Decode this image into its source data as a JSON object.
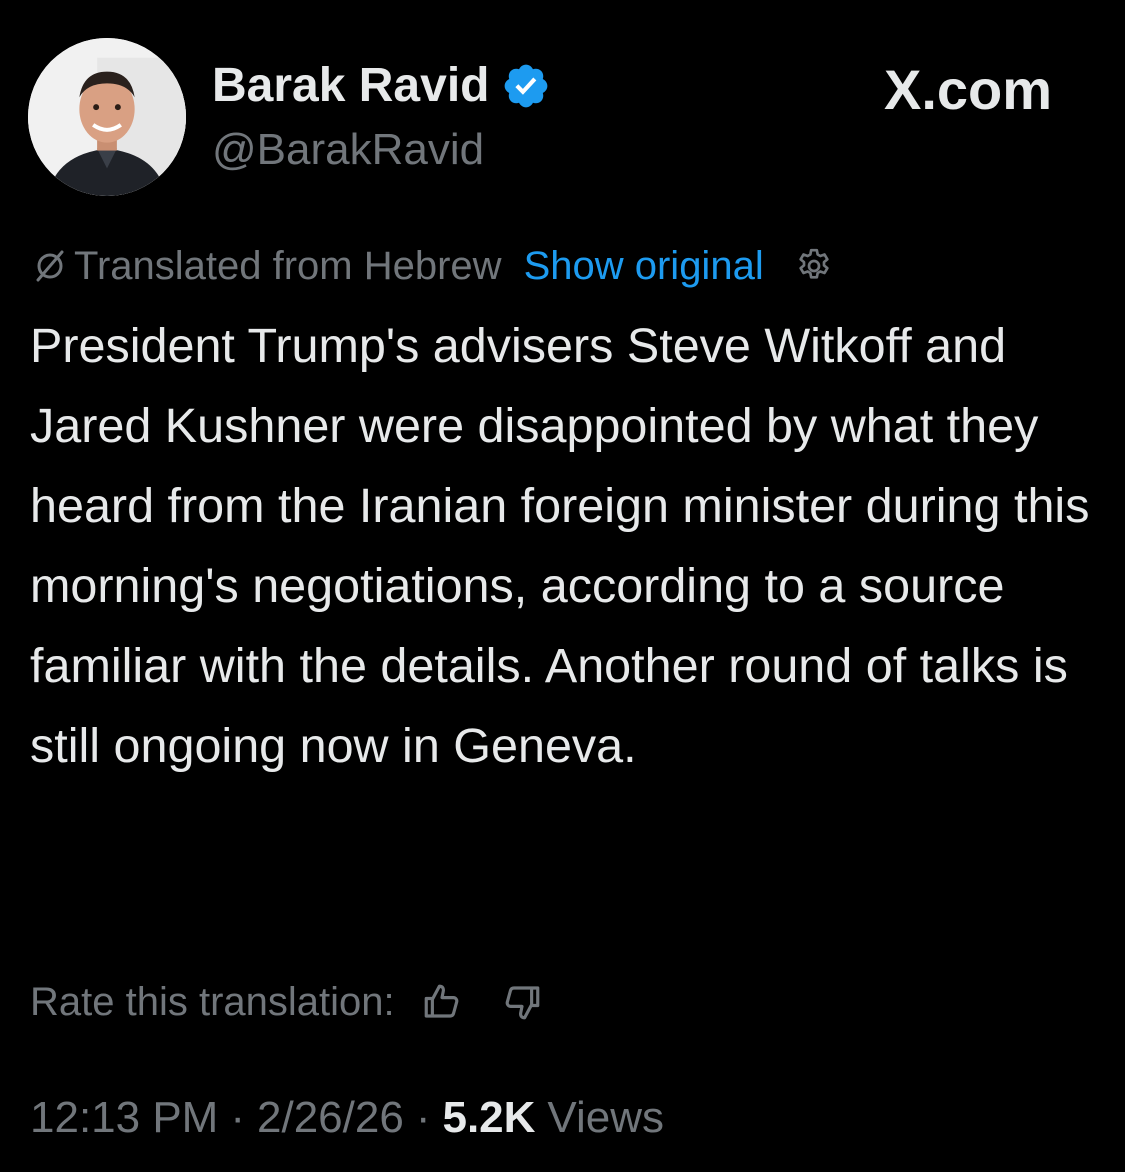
{
  "author": {
    "display_name": "Barak Ravid",
    "handle": "@BarakRavid",
    "verified_icon": "verified-badge-icon",
    "avatar_icon": "profile-photo"
  },
  "brand": {
    "label": "X.com"
  },
  "translation": {
    "label": "Translated from Hebrew",
    "show_original": "Show original",
    "translate_icon": "translate-icon",
    "settings_icon": "gear-icon"
  },
  "tweet": {
    "text": "President Trump's advisers Steve Witkoff and Jared Kushner were disappointed by what they heard from the Iranian foreign minister during this morning's negotiations, according to a source familiar with the details. Another round of talks is still ongoing now in Geneva."
  },
  "rating": {
    "label": "Rate this translation:",
    "thumbs_up_icon": "thumbs-up-icon",
    "thumbs_down_icon": "thumbs-down-icon"
  },
  "meta": {
    "time": "12:13 PM",
    "separator": "·",
    "date": "2/26/26",
    "views_count": "5.2K",
    "views_label": "Views"
  },
  "colors": {
    "background": "#000000",
    "primary_text": "#e7e9ea",
    "secondary_text": "#71767b",
    "accent": "#1d9bf0"
  }
}
